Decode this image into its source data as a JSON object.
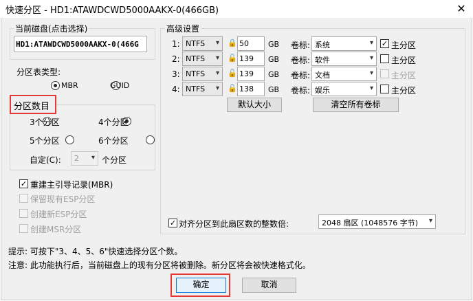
{
  "window": {
    "title": "快速分区 - HD1:ATAWDCWD5000AAKX-0(466GB)",
    "close": "✕"
  },
  "current_disk": {
    "legend": "当前磁盘(点击选择)",
    "value": "HD1:ATAWDCWD5000AAKX-0(466G"
  },
  "partition_table": {
    "label": "分区表类型:",
    "mbr": "MBR",
    "guid": "GUID",
    "selected": "MBR"
  },
  "partition_count": {
    "legend": "分区数目",
    "options": [
      "3个分区",
      "4个分区",
      "5个分区",
      "6个分区"
    ],
    "selected": "4个分区",
    "custom_label": "自定(C):",
    "custom_value": "2",
    "custom_suffix": "个分区"
  },
  "options": {
    "rebuild_mbr": "重建主引导记录(MBR)",
    "keep_esp": "保留现有ESP分区",
    "create_esp": "创建新ESP分区",
    "create_msr": "创建MSR分区"
  },
  "advanced": {
    "legend": "高级设置",
    "unit": "GB",
    "vol_label": "卷标:",
    "primary": "主分区",
    "rows": [
      {
        "idx": "1:",
        "fs": "NTFS",
        "size": "50",
        "label": "系统",
        "primary": true
      },
      {
        "idx": "2:",
        "fs": "NTFS",
        "size": "139",
        "label": "软件",
        "primary": false
      },
      {
        "idx": "3:",
        "fs": "NTFS",
        "size": "139",
        "label": "文档",
        "primary": false
      },
      {
        "idx": "4:",
        "fs": "NTFS",
        "size": "138",
        "label": "娱乐",
        "primary": false
      }
    ],
    "default_size_btn": "默认大小",
    "clear_labels_btn": "清空所有卷标",
    "align_label": "对齐分区到此扇区数的整数倍:",
    "align_value": "2048 扇区 (1048576 字节)"
  },
  "hints": {
    "line1": "提示: 可按下\"3、4、5、6\"快速选择分区个数。",
    "line2": "注意: 此功能执行后，当前磁盘上的现有分区将被删除。新分区将会被快速格式化。"
  },
  "buttons": {
    "ok": "确定",
    "cancel": "取消"
  }
}
